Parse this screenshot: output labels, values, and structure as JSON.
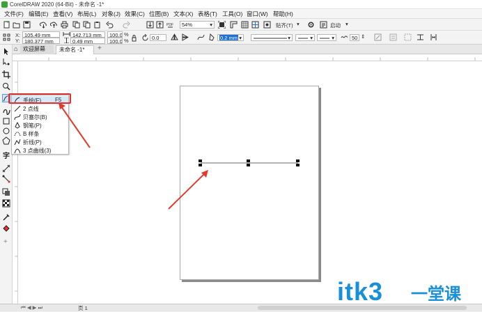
{
  "window": {
    "title": "CorelDRAW 2020 (64-Bit) - 未命名 -1*"
  },
  "menu": [
    "文件(F)",
    "编辑(E)",
    "查看(V)",
    "布局(L)",
    "对象(J)",
    "效果(C)",
    "位图(B)",
    "文本(X)",
    "表格(T)",
    "工具(O)",
    "窗口(W)",
    "帮助(H)"
  ],
  "toolbar1": {
    "zoom": "54%",
    "snap_label": "贴齐(T)",
    "launch_label": "启动"
  },
  "props": {
    "x_label": "X:",
    "x": "105.49 mm",
    "y_label": "Y:",
    "y": "180.377 mm",
    "w": "142.713 mm",
    "h": "0.49 mm",
    "sx": "100.0",
    "sy": "100.0",
    "pct": "%",
    "angle": "0.0",
    "outline_width": "0.2 mm",
    "smooth": "50"
  },
  "tabs": {
    "welcome": "欢迎屏幕",
    "doc": "未命名 -1*",
    "add": "+"
  },
  "flyout": {
    "items": [
      {
        "label": "手绘(F)",
        "shortcut": "F5"
      },
      {
        "label": "2 点线"
      },
      {
        "label": "贝塞尔(B)"
      },
      {
        "label": "钢笔(P)"
      },
      {
        "label": "B 样条"
      },
      {
        "label": "折线(P)"
      },
      {
        "label": "3 点曲线(3)"
      }
    ]
  },
  "status": {
    "page": "页 1"
  },
  "watermark": {
    "main": "itk3",
    "sub": "一堂课"
  },
  "colors": {
    "highlight": "#e03030",
    "arrow": "#e23a2e",
    "watermark": "#1a8fd9",
    "selection": "#1e6fd9"
  },
  "icons": [
    "pick-tool-icon",
    "shape-tool-icon",
    "crop-tool-icon",
    "zoom-tool-icon",
    "freehand-tool-icon",
    "artistic-media-icon",
    "rectangle-tool-icon",
    "ellipse-tool-icon",
    "polygon-tool-icon",
    "text-tool-icon",
    "parallel-dimension-icon",
    "connector-icon",
    "drop-shadow-icon",
    "transparency-icon",
    "eyedropper-icon",
    "interactive-fill-icon",
    "add-icon"
  ]
}
